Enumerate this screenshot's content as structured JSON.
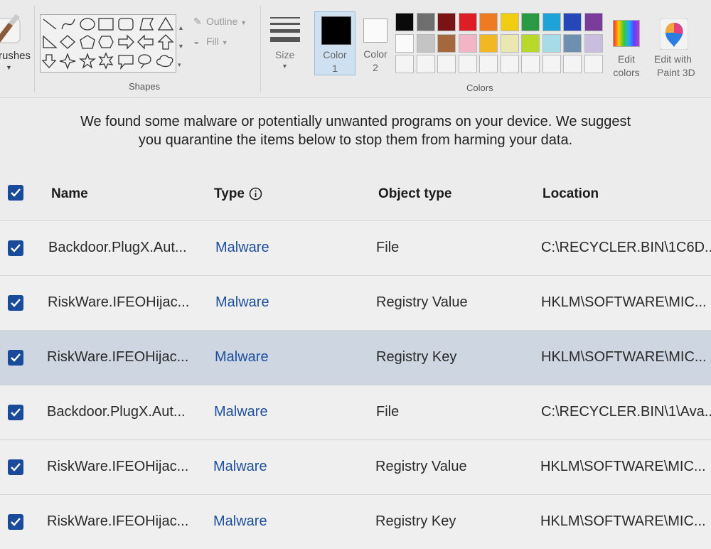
{
  "ribbon": {
    "brushes_label": "rushes",
    "shapes_label": "Shapes",
    "outline_label": "Outline",
    "fill_label": "Fill",
    "size_label": "Size",
    "color1_label": "Color",
    "color1_num": "1",
    "color2_label": "Color",
    "color2_num": "2",
    "colors_label": "Colors",
    "edit_colors_line1": "Edit",
    "edit_colors_line2": "colors",
    "paint3d_line1": "Edit with",
    "paint3d_line2": "Paint 3D",
    "palette_row1": [
      "#0a0a0a",
      "#6e6e6e",
      "#7a1414",
      "#dd1f25",
      "#ee7a22",
      "#f0cd13",
      "#2a9944",
      "#1ea3d8",
      "#2547b8",
      "#7a3c9a"
    ],
    "palette_row2": [
      "#fafafa",
      "#c4c4c4",
      "#a5683c",
      "#f2b5c6",
      "#f2b824",
      "#ece6b2",
      "#b7d92a",
      "#a8dbe8",
      "#6d8fb0",
      "#c9bde0"
    ]
  },
  "message": "We found some malware or potentially unwanted programs on your device. We suggest you quarantine the items below to stop them from harming your data.",
  "table": {
    "headers": {
      "name": "Name",
      "type": "Type",
      "object_type": "Object type",
      "location": "Location"
    },
    "rows": [
      {
        "name": "Backdoor.PlugX.Aut...",
        "type": "Malware",
        "object_type": "File",
        "location": "C:\\RECYCLER.BIN\\1C6D..."
      },
      {
        "name": "RiskWare.IFEOHijac...",
        "type": "Malware",
        "object_type": "Registry Value",
        "location": "HKLM\\SOFTWARE\\MIC..."
      },
      {
        "name": "RiskWare.IFEOHijac...",
        "type": "Malware",
        "object_type": "Registry Key",
        "location": "HKLM\\SOFTWARE\\MIC..."
      },
      {
        "name": "Backdoor.PlugX.Aut...",
        "type": "Malware",
        "object_type": "File",
        "location": "C:\\RECYCLER.BIN\\1\\Ava..."
      },
      {
        "name": "RiskWare.IFEOHijac...",
        "type": "Malware",
        "object_type": "Registry Value",
        "location": "HKLM\\SOFTWARE\\MIC..."
      },
      {
        "name": "RiskWare.IFEOHijac...",
        "type": "Malware",
        "object_type": "Registry Key",
        "location": "HKLM\\SOFTWARE\\MIC..."
      }
    ]
  },
  "icons": {
    "brush": "brush-icon",
    "outline": "outline-icon",
    "fill": "fill-icon",
    "size": "size-icon",
    "edit_colors": "edit-colors-icon",
    "paint3d": "paint3d-icon",
    "info": "info-icon",
    "checkbox": "check-icon"
  },
  "colors": {
    "accent_blue": "#1a4b9a",
    "link_blue": "#1d4f9c",
    "selected_row": "#cdd6e1"
  }
}
